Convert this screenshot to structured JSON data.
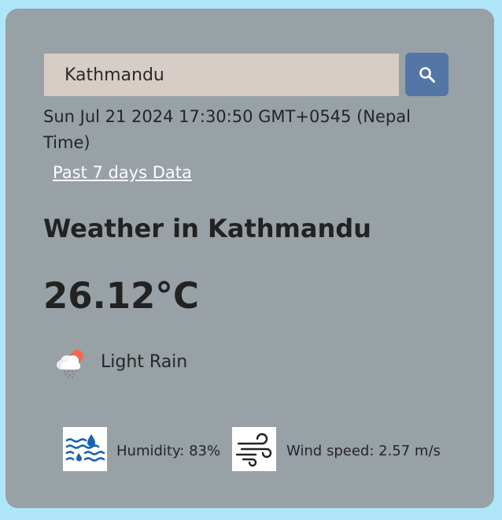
{
  "search": {
    "value": "Kathmandu"
  },
  "datetime": "Sun Jul 21 2024 17:30:50 GMT+0545 (Nepal Time)",
  "past_link": "Past 7 days Data",
  "weather": {
    "title": "Weather in Kathmandu",
    "temperature": "26.12°C",
    "condition": "Light Rain",
    "condition_icon": "cloud-sun-rain-icon",
    "humidity": "Humidity: 83%",
    "humidity_icon": "humidity-icon",
    "wind": "Wind speed: 2.57 m/s",
    "wind_icon": "wind-icon"
  },
  "colors": {
    "page_background": "#aee6f8",
    "card_background": "#98a1a5",
    "search_input_background": "#d6cdc7",
    "search_button": "#5476a6",
    "humidity_icon": "#1a63b0"
  }
}
